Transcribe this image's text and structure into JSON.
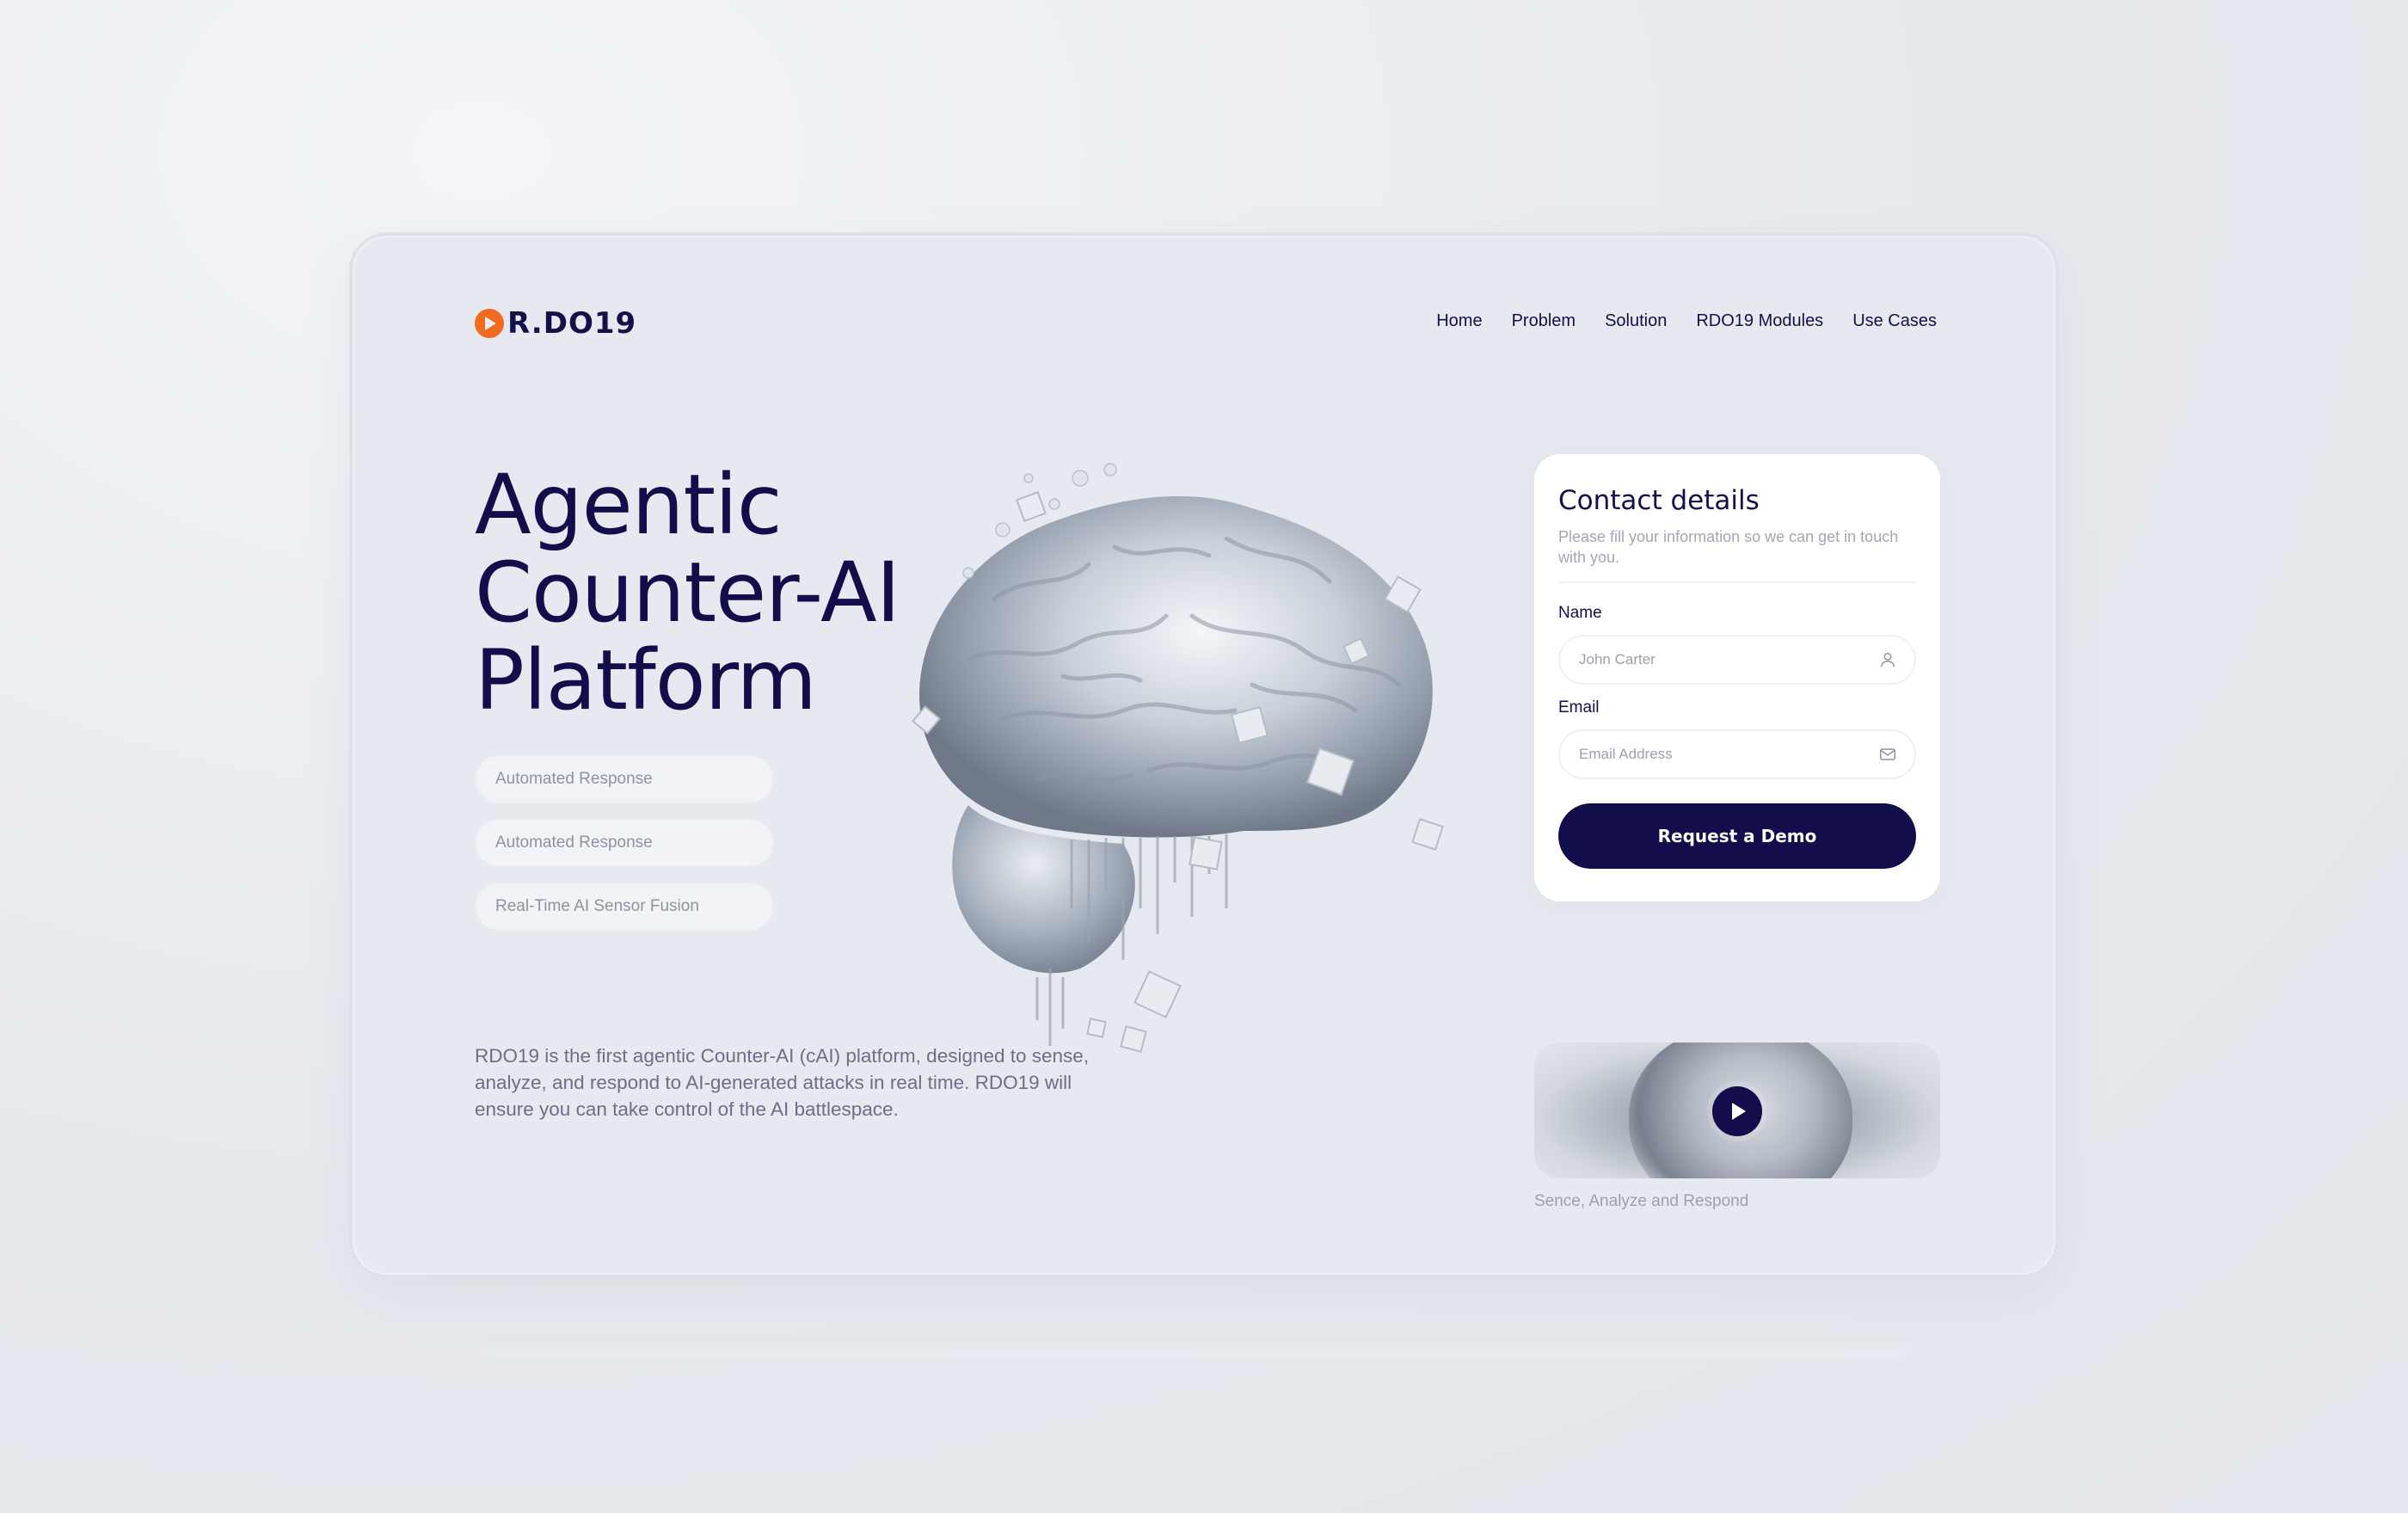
{
  "brand": {
    "name": "R.DO19"
  },
  "nav": {
    "items": [
      "Home",
      "Problem",
      "Solution",
      "RDO19 Modules",
      "Use Cases"
    ]
  },
  "hero": {
    "title_lines": [
      "Agentic",
      "Counter-AI",
      "Platform"
    ],
    "chips": [
      "Automated Response",
      "Automated Response",
      "Real-Time AI Sensor Fusion"
    ],
    "description": "RDO19 is the first agentic Counter-AI (cAI) platform, designed to sense, analyze, and respond to AI-generated attacks in real time.  RDO19 will ensure you can take control of the AI battlespace."
  },
  "form": {
    "title": "Contact details",
    "subtitle": "Please fill your information so we can get in touch with you.",
    "name_label": "Name",
    "name_placeholder": "John Carter",
    "name_icon": "user-icon",
    "email_label": "Email",
    "email_placeholder": "Email Address",
    "email_icon": "mail-icon",
    "submit_label": "Request a Demo"
  },
  "video": {
    "caption": "Sence, Analyze and Respond",
    "play_icon": "play-icon"
  },
  "colors": {
    "accent": "#f26a1b",
    "primary": "#120d4b",
    "background": "#e6e9ef"
  }
}
